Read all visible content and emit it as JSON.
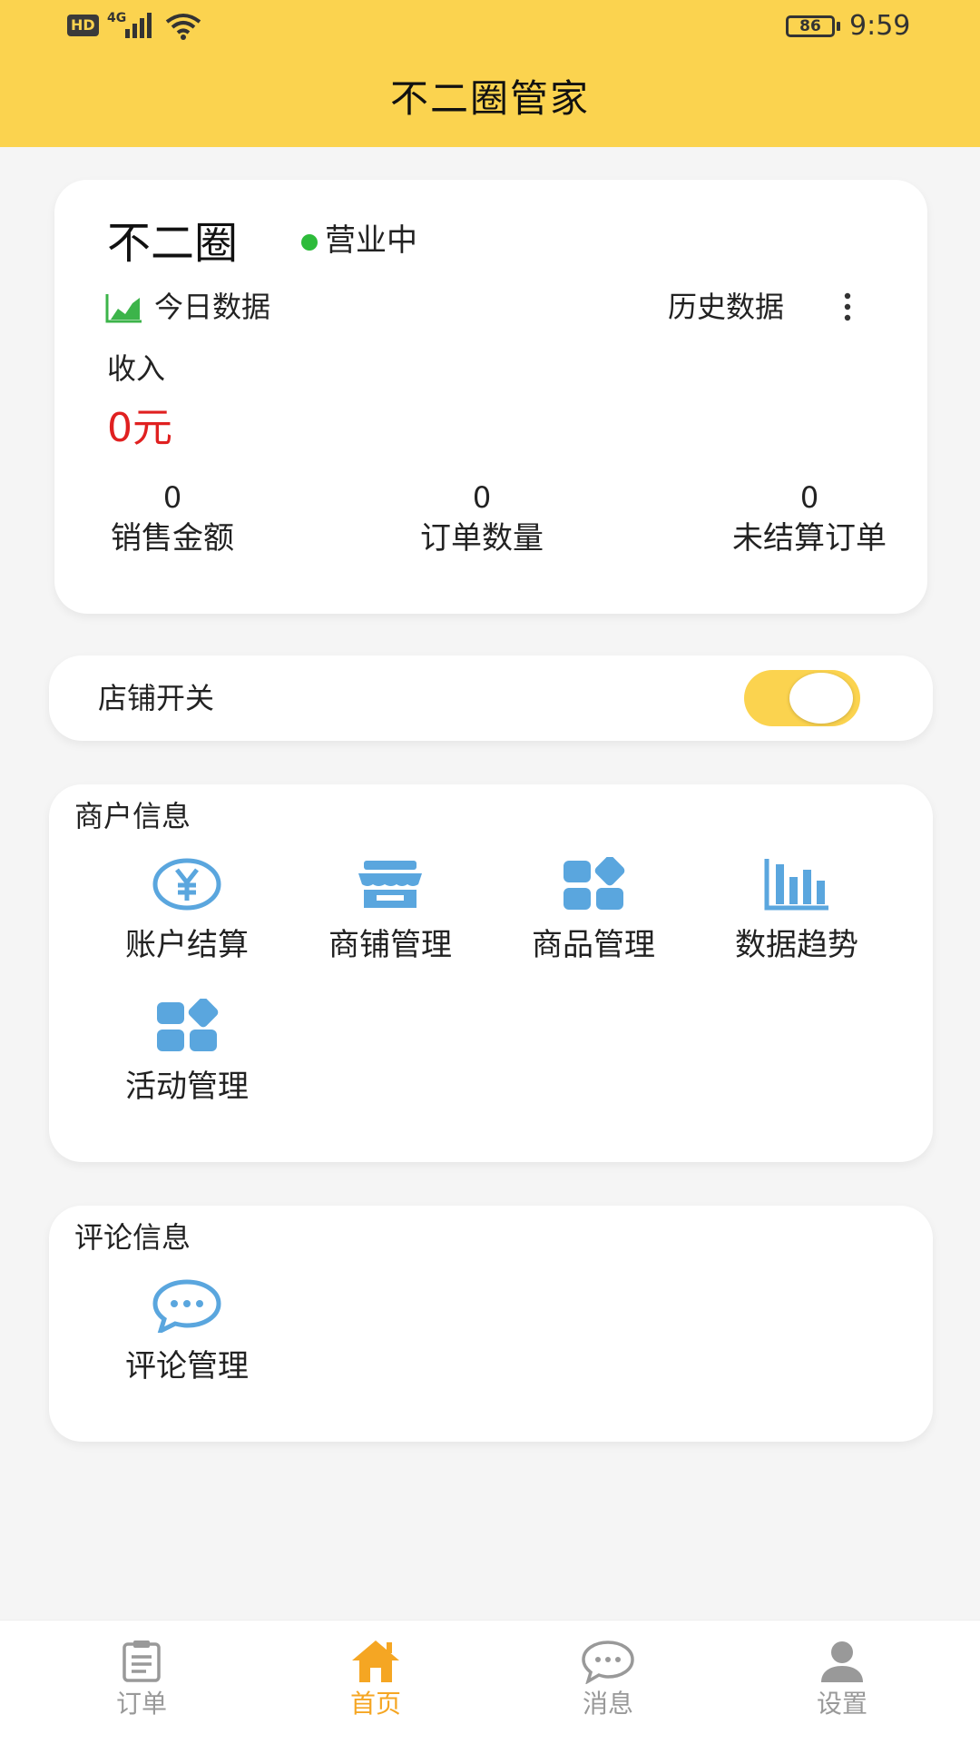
{
  "status_bar": {
    "hd": "HD",
    "network": "4G",
    "battery": "86",
    "time": "9:59"
  },
  "header": {
    "title": "不二圈管家"
  },
  "store": {
    "name": "不二圈",
    "status": "营业中",
    "today_label": "今日数据",
    "history_label": "历史数据",
    "income_label": "收入",
    "income_value": "0元",
    "stats": [
      {
        "value": "0",
        "label": "销售金额"
      },
      {
        "value": "0",
        "label": "订单数量"
      },
      {
        "value": "0",
        "label": "未结算订单"
      }
    ]
  },
  "store_switch": {
    "label": "店铺开关",
    "on": true
  },
  "merchant": {
    "title": "商户信息",
    "items": [
      {
        "label": "账户结算",
        "icon": "yen-icon"
      },
      {
        "label": "商铺管理",
        "icon": "shop-icon"
      },
      {
        "label": "商品管理",
        "icon": "apps-icon"
      },
      {
        "label": "数据趋势",
        "icon": "bar-chart-icon"
      },
      {
        "label": "活动管理",
        "icon": "apps-icon"
      }
    ]
  },
  "review": {
    "title": "评论信息",
    "items": [
      {
        "label": "评论管理",
        "icon": "chat-icon"
      }
    ]
  },
  "tabbar": {
    "items": [
      {
        "label": "订单",
        "icon": "order-icon",
        "active": false
      },
      {
        "label": "首页",
        "icon": "home-icon",
        "active": true
      },
      {
        "label": "消息",
        "icon": "message-icon",
        "active": false
      },
      {
        "label": "设置",
        "icon": "user-icon",
        "active": false
      }
    ]
  },
  "colors": {
    "brand_yellow": "#fbd34f",
    "icon_blue": "#5aa6de",
    "income_red": "#e02020",
    "status_green": "#2dbb3a",
    "tab_active": "#f5a623",
    "tab_inactive": "#999999"
  }
}
